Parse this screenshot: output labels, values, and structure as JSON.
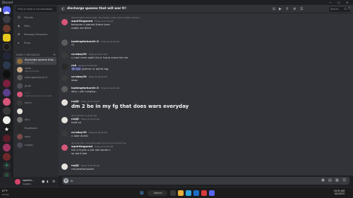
{
  "window": {
    "title": "Discord",
    "minimize": "—",
    "maximize": "☐",
    "close": "✕"
  },
  "sidebar": {
    "search_placeholder": "Find or start a conversation",
    "nav": [
      {
        "label": "Friends",
        "icon": "friends-icon"
      },
      {
        "label": "Nitro",
        "icon": "nitro-icon"
      },
      {
        "label": "Message Requests",
        "icon": "message-requests-icon"
      },
      {
        "label": "Shop",
        "icon": "shop-icon"
      }
    ],
    "dm_header": "DIRECT MESSAGES",
    "dm_add": "+",
    "dms": [
      {
        "name": "discharge queens that...",
        "sub": "9 Members"
      },
      {
        "name": "carla",
        "sub": "Playing Fortnite"
      },
      {
        "name": "lookingforkurdi<3",
        "sub": ""
      },
      {
        "name": "gruki",
        "sub": ""
      },
      {
        "name": "ﾉ ﾉ ﾉ",
        "sub": "i just found a love cuz i cantt..."
      },
      {
        "name": "fickm",
        "sub": ""
      },
      {
        "name": "",
        "sub": ""
      },
      {
        "name": "ditu",
        "sub": ""
      },
      {
        "name": "floodlover",
        "sub": ""
      },
      {
        "name": "ozzy",
        "sub": ""
      },
      {
        "name": "rntydn",
        "sub": ""
      }
    ]
  },
  "user_panel": {
    "username": "squirtin...",
    "status": "Invisible"
  },
  "header": {
    "channel": "discharge queens that will war fr!",
    "search_placeholder": "Search"
  },
  "messages": [
    {
      "reply": "@Lookingforkurdi<3 what - the makes u joke irl even before cheese u",
      "user": "squirtingpond",
      "time": "Today at 10:16 AM",
      "lines": [
        "because u werent there bum",
        "make me bitch"
      ]
    },
    {
      "user": "lookingforkurdi<3",
      "time": "Today at 10:16 AM",
      "lines": [
        "??"
      ]
    },
    {
      "user": "ca'oboy39",
      "time": "Today at 10:17 AM",
      "lines": [
        "u cant even spell rid ur tryna come for me"
      ]
    },
    {
      "user": "rnh",
      "time": "Today at 10:18 AM",
      "mention": "@nnJiji",
      "after": " gimme ur ankle tag"
    },
    {
      "user": "ca'oboy39",
      "time": "Today at 10:20 AM",
      "lines": [
        "stow"
      ]
    },
    {
      "user": "lookingforkurdi<3",
      "time": "Today at 10:25 AM",
      "lines": [
        "why r yall surging..."
      ]
    },
    {
      "user": "nnJiji",
      "time": "Today at 10:25 AM",
      "big": "dm 2 be in my fg that does wars everyday"
    },
    {
      "reply": "@rnh gimme ur ankle tag",
      "user": "nnJiji",
      "time": "Today at 10:25 AM",
      "lines": [
        "hold on"
      ]
    },
    {
      "user": "ca'oboy39",
      "time": "Today at 10:25 AM",
      "lines": [
        "u look dumb"
      ]
    },
    {
      "reply": "@ca'oboy39 u cant even spell rid ur tryna come for me",
      "user": "squirtingpond",
      "time": "Today at 10:26 AM",
      "lines": [
        "rid ur tryna u are not words s",
        "so dont talk"
      ]
    },
    {
      "user": "nnJiji",
      "time": "Today at 10:26 AM",
      "lines": [
        "canyawhomyaan"
      ]
    }
  ],
  "composer": {
    "plus": "+",
    "value": "hi"
  },
  "taskbar": {
    "weather_temp": "67°F",
    "weather_desc": "Sunny",
    "search_label": "Search",
    "time": "10:31 AM",
    "date": "9/1/2023"
  },
  "colors": {
    "accent": "#5865f2",
    "background": "#313338",
    "sidebar": "#2b2d31",
    "rail": "#1e1f22",
    "online": "#23a55a"
  }
}
